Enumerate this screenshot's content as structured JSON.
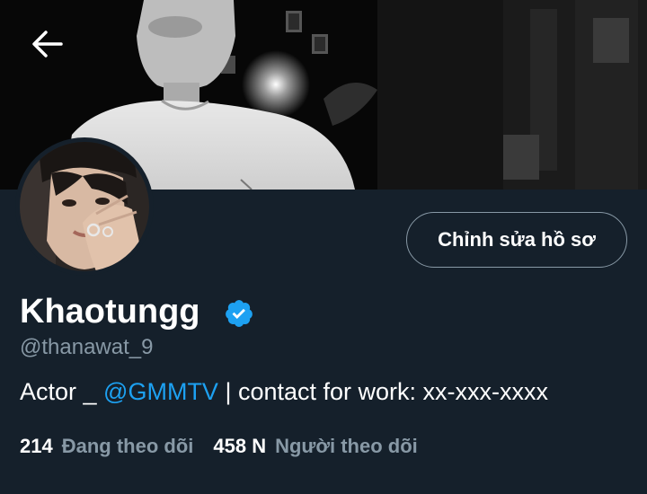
{
  "profile": {
    "display_name": "Khaotungg",
    "handle": "@thanawat_9",
    "verified": true,
    "bio": {
      "prefix": "Actor _ ",
      "mention": "@GMMTV",
      "suffix": " | contact for work: xx-xxx-xxxx"
    }
  },
  "actions": {
    "edit_profile_label": "Chỉnh sửa hồ sơ"
  },
  "stats": {
    "following_count": "214",
    "following_label": "Đang theo dõi",
    "followers_count": "458 N",
    "followers_label": "Người theo dõi"
  },
  "icons": {
    "back": "back-arrow-icon",
    "verified": "verified-badge-icon"
  },
  "colors": {
    "background": "#15202b",
    "accent": "#1da1f2",
    "secondary_text": "#8899a6",
    "primary_text": "#ffffff"
  }
}
